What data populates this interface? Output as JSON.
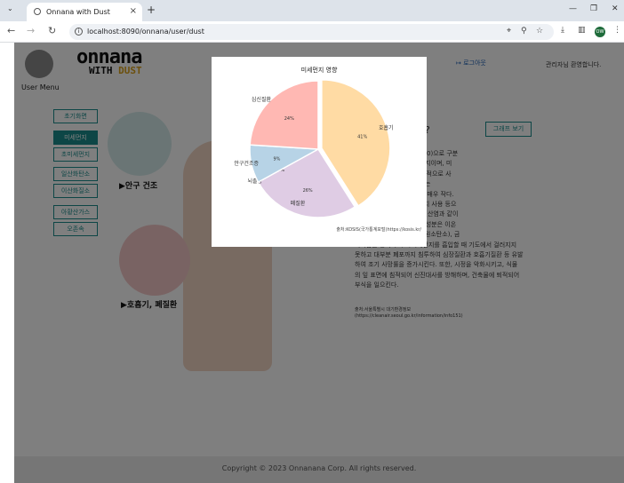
{
  "browser": {
    "tab_title": "Onnana with Dust",
    "url": "localhost:8090/onnana/user/dust",
    "profile_initials": "OW"
  },
  "header": {
    "user_menu_label": "User Menu",
    "logo_line1": "onnana",
    "logo_line2_a": "WITH ",
    "logo_line2_b": "DUST",
    "nav_logout": "로그아웃",
    "welcome": "관리자님 환영합니다."
  },
  "sidebar": {
    "items": [
      {
        "label": "초기화면",
        "active": false
      },
      {
        "label": "미세먼지",
        "active": true
      },
      {
        "label": "초미세먼지",
        "active": false
      },
      {
        "label": "일산화탄소",
        "active": false
      },
      {
        "label": "이산화질소",
        "active": false
      },
      {
        "label": "아황산가스",
        "active": false
      },
      {
        "label": "오존속",
        "active": false
      }
    ]
  },
  "main": {
    "caption_eye": "▶안구 건조",
    "caption_lung": "▶호흡기, 폐질환",
    "question_mark": "?",
    "graph_button": "그래프 보기",
    "body_text": "PM-2.5)와 미세먼지(PM-10)으로 구분\n)는 직경이 2.5㎛이하인 먼지이며, 미\n10㎛이하인 먼지이다. 일반적으로 사\n할 때 초미세먼지(PM-2.5)는\n-10)의 1/6~1/7일 정도로 매우 작다.\n시설, 자동차, 난방 및 에너지 사용 등으\n배출되기도 하고, 황산염, 질산염과 같이\n생성되기도 한다. 주요 구성성분은 이온\n(4+), 탄소성분(유기탄소, 원소탄소), 금\n속화합물 등이다. (초)미세먼지를 흡입할 때 기도에서 걸러지지\n못하고 대부분 폐포까지 침투하여 심장질환과 호흡기질환 등 유발\n하여 조기 사망률을 증가시킨다. 또한, 시정을 악화시키고, 식물\n의 잎 표면에 침적되어 신진대사를 방해하며, 건축물에 퇴적되어\n부식을 일으킨다.",
    "source_text": "출처:서울특별시 대기환경정보\n(https://cleanair.seoul.go.kr/information/info151)"
  },
  "footer": {
    "copyright": "Copyright © 2023 Onnanana Corp. All rights reserved."
  },
  "chart_data": {
    "type": "pie",
    "title": "미세먼지 영향",
    "categories": [
      "호흡기",
      "폐질환",
      "뇌졸중",
      "안구건조증",
      "심신질환"
    ],
    "values": [
      41,
      26,
      0,
      9,
      24
    ],
    "value_labels": [
      "41%",
      "26%",
      "0%",
      "9%",
      "24%"
    ],
    "colors": [
      "#ffdba4",
      "#dfcce4",
      "#b8a7c9",
      "#b7d3e6",
      "#ffb8b3"
    ],
    "source": "출처:KOSIS(국가통계포털)https://kosis.kr/"
  }
}
